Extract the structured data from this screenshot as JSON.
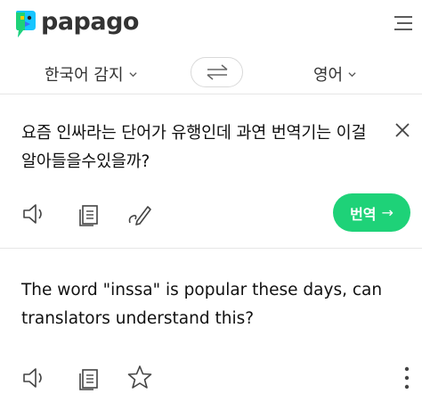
{
  "app": {
    "name": "papago",
    "brand_color": "#1ed278",
    "logo_colors": [
      "#17c5ff",
      "#1ed278",
      "#ffcc00",
      "#3a6ff7"
    ]
  },
  "header": {
    "logo_text": "papago",
    "menu_icon": "hamburger-menu-icon"
  },
  "languages": {
    "source": "한국어 감지",
    "target": "영어",
    "swap_icon": "swap-arrows-icon"
  },
  "source_panel": {
    "text": "요즘 인싸라는 단어가 유행인데 과연 번역기는 이걸 알아들을수있을까?",
    "clear_icon": "close-icon",
    "tools": [
      "speaker-icon",
      "copy-icon",
      "handwriting-icon"
    ],
    "translate_label": "번역",
    "translate_arrow": "→"
  },
  "target_panel": {
    "text": "The word \"inssa\" is popular these days, can translators understand this?",
    "tools": [
      "speaker-icon",
      "copy-icon",
      "star-icon"
    ],
    "more_icon": "more-vertical-icon"
  }
}
